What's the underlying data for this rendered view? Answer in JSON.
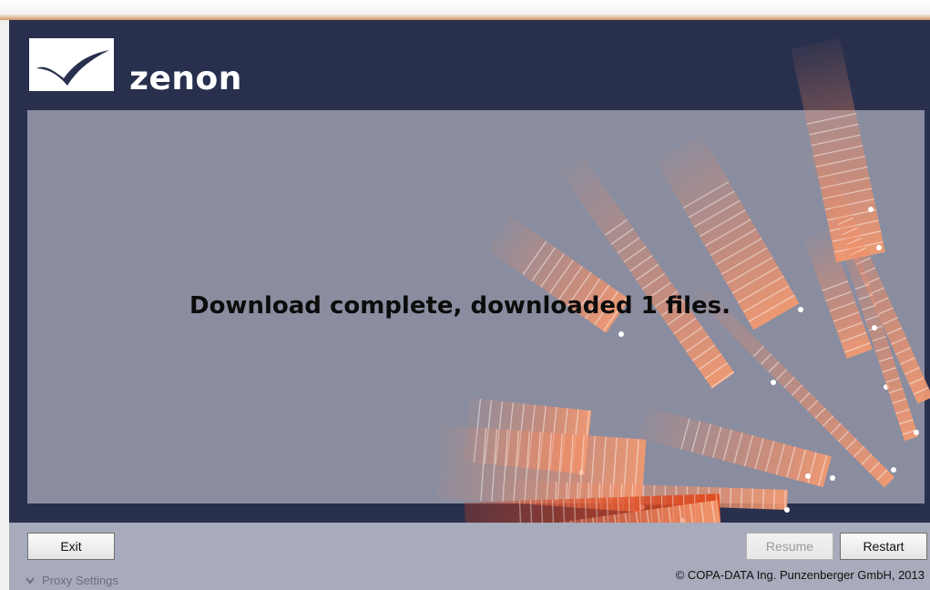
{
  "app": {
    "logo_text": "zenon",
    "logo_icon": "zenon-logo-icon",
    "header_color": "#29304e",
    "accent_color": "#f08a63"
  },
  "main": {
    "status_message": "Download complete, downloaded 1 files."
  },
  "footer": {
    "exit_label": "Exit",
    "resume_label": "Resume",
    "restart_label": "Restart",
    "proxy_settings_label": "Proxy Settings",
    "proxy_icon": "chevron-down-icon",
    "copyright": "© COPA-DATA Ing. Punzenberger GmbH, 2013"
  }
}
